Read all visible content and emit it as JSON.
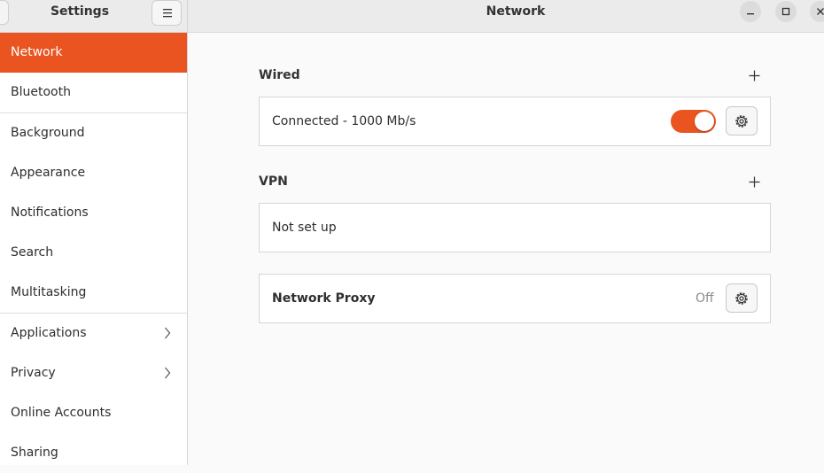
{
  "window": {
    "sidebar_title": "Settings",
    "page_title": "Network"
  },
  "sidebar": {
    "items": [
      {
        "label": "Network",
        "active": true
      },
      {
        "label": "Bluetooth"
      },
      {
        "label": "Background"
      },
      {
        "label": "Appearance"
      },
      {
        "label": "Notifications"
      },
      {
        "label": "Search"
      },
      {
        "label": "Multitasking"
      },
      {
        "label": "Applications",
        "has_submenu": true
      },
      {
        "label": "Privacy",
        "has_submenu": true
      },
      {
        "label": "Online Accounts"
      },
      {
        "label": "Sharing"
      }
    ]
  },
  "wired": {
    "title": "Wired",
    "connection_label": "Connected - 1000 Mb/s",
    "enabled": true
  },
  "vpn": {
    "title": "VPN",
    "status": "Not set up"
  },
  "proxy": {
    "label": "Network Proxy",
    "status": "Off"
  },
  "colors": {
    "accent": "#e95420",
    "header_bg": "#ebebeb",
    "content_bg": "#fafafa"
  },
  "icons": [
    "hamburger-menu-icon",
    "minimize-icon",
    "maximize-icon",
    "close-icon",
    "plus-icon",
    "gear-icon",
    "chevron-right-icon"
  ]
}
